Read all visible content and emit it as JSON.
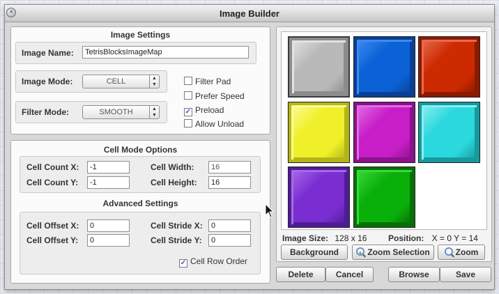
{
  "window": {
    "title": "Image Builder",
    "close_glyph": "×"
  },
  "image_settings": {
    "heading": "Image Settings",
    "image_name_label": "Image Name:",
    "image_name_value": "TetrisBlocksImageMap",
    "image_mode_label": "Image Mode:",
    "image_mode_value": "CELL",
    "filter_mode_label": "Filter Mode:",
    "filter_mode_value": "SMOOTH",
    "checkboxes": [
      {
        "label": "Filter Pad",
        "checked": false,
        "mark": ""
      },
      {
        "label": "Prefer Speed",
        "checked": false,
        "mark": ""
      },
      {
        "label": "Preload",
        "checked": true,
        "mark": "✓"
      },
      {
        "label": "Allow Unload",
        "checked": false,
        "mark": ""
      }
    ]
  },
  "cell_mode": {
    "heading": "Cell Mode Options",
    "cell_count_x_label": "Cell Count X:",
    "cell_count_x": "-1",
    "cell_count_y_label": "Cell Count Y:",
    "cell_count_y": "-1",
    "cell_width_label": "Cell Width:",
    "cell_width": "16",
    "cell_height_label": "Cell Height:",
    "cell_height": "16"
  },
  "advanced": {
    "heading": "Advanced Settings",
    "cell_offset_x_label": "Cell Offset X:",
    "cell_offset_x": "0",
    "cell_offset_y_label": "Cell Offset Y:",
    "cell_offset_y": "0",
    "cell_stride_x_label": "Cell Stride X:",
    "cell_stride_x": "0",
    "cell_stride_y_label": "Cell Stride Y:",
    "cell_stride_y": "0",
    "cell_row_order_label": "Cell Row Order",
    "cell_row_order_mark": "✓"
  },
  "preview": {
    "tiles": [
      {
        "name": "gray",
        "color": "#b9b9b9",
        "light": "#e2e2e2",
        "dark": "#8c8c8c",
        "selected": true
      },
      {
        "name": "blue",
        "color": "#0b62d6",
        "light": "#3f8bf0",
        "dark": "#0a3f96"
      },
      {
        "name": "red",
        "color": "#cc2a00",
        "light": "#e86a4e",
        "dark": "#8a1a00"
      },
      {
        "name": "yellow",
        "color": "#f0f02a",
        "light": "#fbfb9a",
        "dark": "#b4b41a"
      },
      {
        "name": "magenta",
        "color": "#c81ec8",
        "light": "#e26ee2",
        "dark": "#8a128a"
      },
      {
        "name": "cyan",
        "color": "#2ad8de",
        "light": "#8aeef0",
        "dark": "#17999d"
      },
      {
        "name": "purple",
        "color": "#7a2ed2",
        "light": "#a66ae8",
        "dark": "#501c96"
      },
      {
        "name": "green",
        "color": "#0ab00a",
        "light": "#3ad83a",
        "dark": "#067006"
      }
    ],
    "image_size_label": "Image Size:",
    "image_size_value": "128 x 16",
    "position_label": "Position:",
    "position_value": "X = 0 Y = 14",
    "background_button": "Background",
    "zoom_selection_button": "Zoom Selection",
    "zoom_button": "Zoom"
  },
  "footer": {
    "delete": "Delete",
    "cancel": "Cancel",
    "browse": "Browse",
    "save": "Save"
  }
}
